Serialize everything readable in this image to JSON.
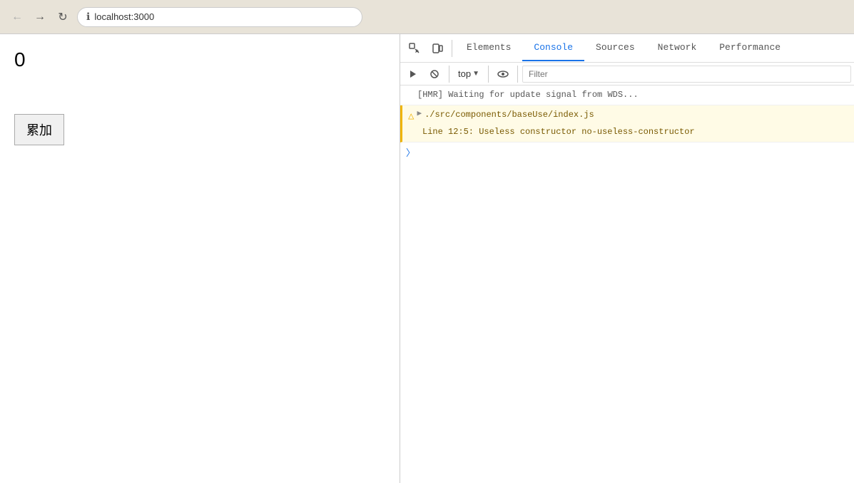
{
  "browser": {
    "back_disabled": true,
    "forward_disabled": true,
    "url": "localhost:3000",
    "info_icon": "ℹ"
  },
  "page": {
    "counter_value": "0",
    "button_label": "累加"
  },
  "devtools": {
    "tabs": [
      {
        "id": "elements",
        "label": "Elements",
        "active": false
      },
      {
        "id": "console",
        "label": "Console",
        "active": true
      },
      {
        "id": "sources",
        "label": "Sources",
        "active": false
      },
      {
        "id": "network",
        "label": "Network",
        "active": false
      },
      {
        "id": "performance",
        "label": "Performance",
        "active": false
      }
    ],
    "toolbar": {
      "context": "top",
      "filter_placeholder": "Filter"
    },
    "console": {
      "messages": [
        {
          "type": "info",
          "text": "[HMR] Waiting for update signal from WDS..."
        },
        {
          "type": "warning",
          "file": "./src/components/baseUse/index.js",
          "detail": "Line 12:5:  Useless constructor  no-useless-constructor"
        }
      ]
    }
  }
}
